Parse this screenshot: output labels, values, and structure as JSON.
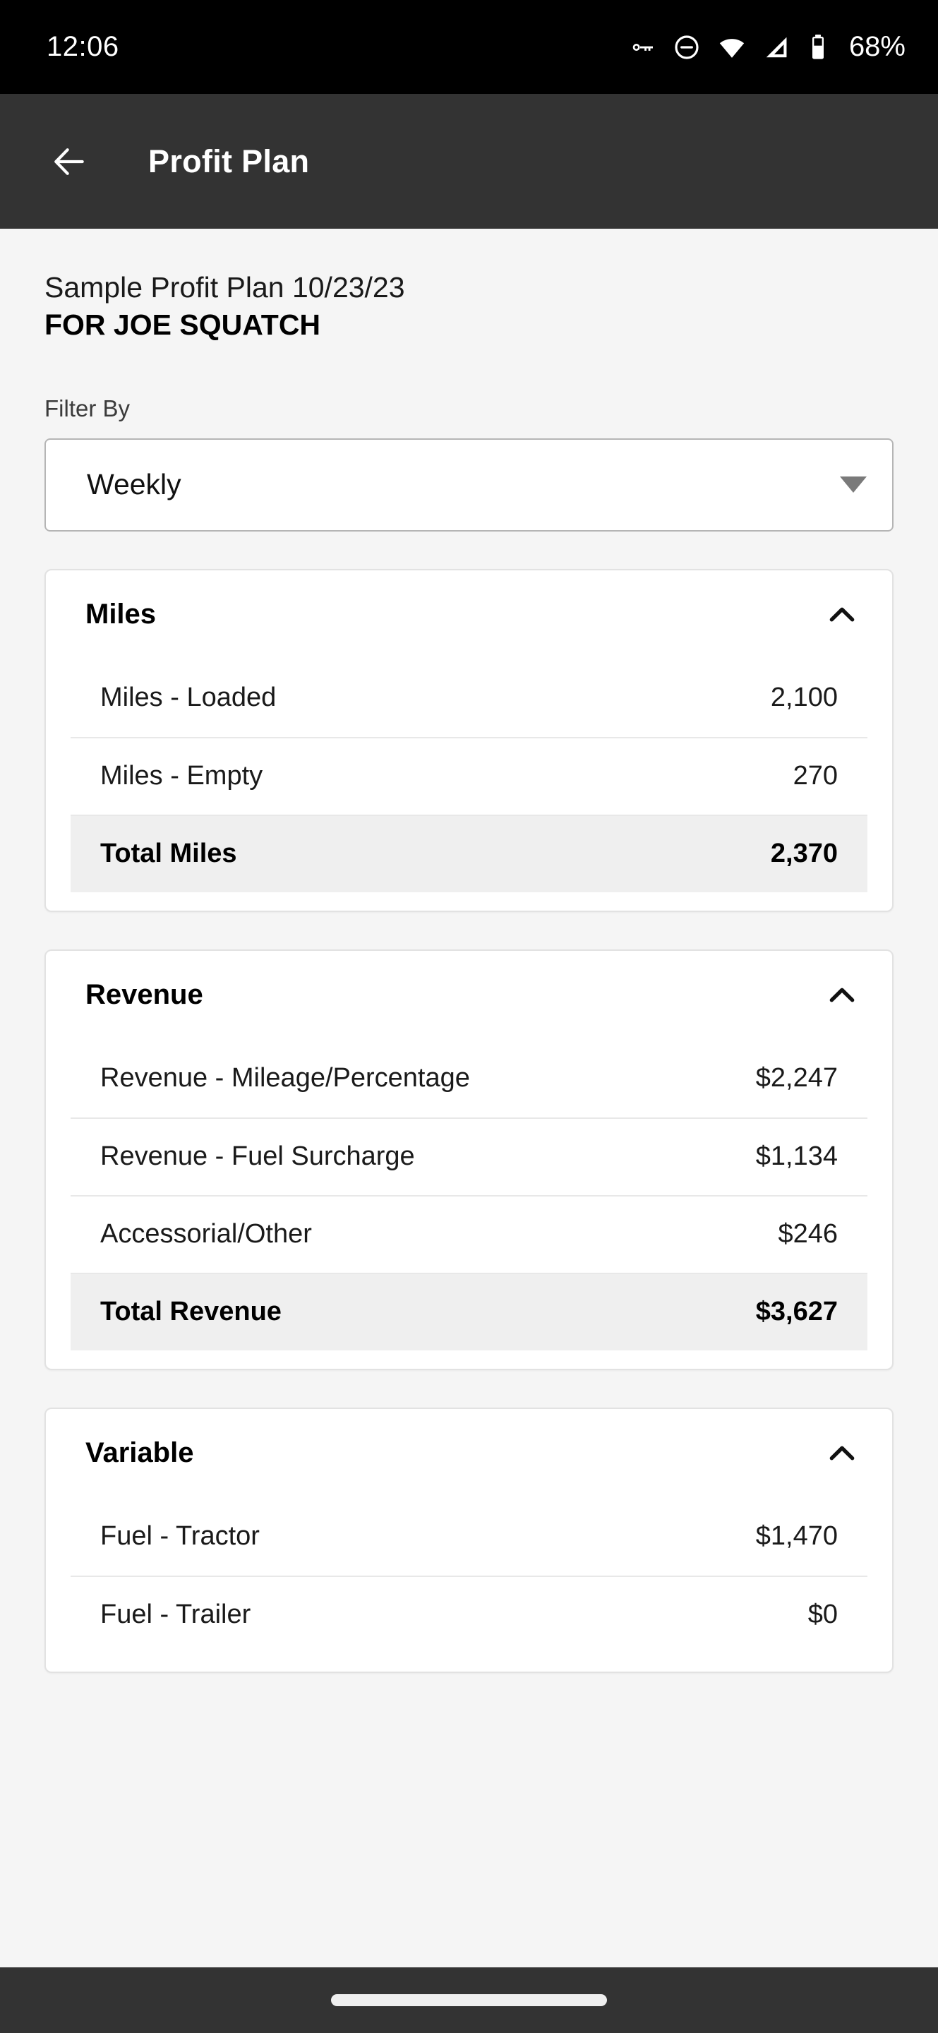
{
  "status_bar": {
    "time": "12:06",
    "battery_label": "68%",
    "icons": [
      "vpn-key-icon",
      "do-not-disturb-icon",
      "wifi-icon",
      "cellular-signal-icon",
      "battery-icon"
    ]
  },
  "app_bar": {
    "back_icon": "back-arrow-icon",
    "title": "Profit Plan"
  },
  "plan": {
    "name": "Sample Profit Plan 10/23/23",
    "owner": "FOR JOE SQUATCH"
  },
  "filter": {
    "label": "Filter By",
    "value": "Weekly",
    "dropdown_icon": "chevron-down-icon"
  },
  "colors": {
    "page_background": "#f5f5f5",
    "app_bar": "#333333",
    "status_bar": "#000000",
    "card_background": "#ffffff",
    "card_border": "#e2e2e2",
    "total_row_background": "#efefef",
    "divider": "#e8e8e8"
  },
  "sections": [
    {
      "title": "Miles",
      "collapse_icon": "chevron-up-icon",
      "rows": [
        {
          "label": "Miles - Loaded",
          "value": "2,100",
          "total": false
        },
        {
          "label": "Miles - Empty",
          "value": "270",
          "total": false
        },
        {
          "label": "Total Miles",
          "value": "2,370",
          "total": true
        }
      ]
    },
    {
      "title": "Revenue",
      "collapse_icon": "chevron-up-icon",
      "rows": [
        {
          "label": "Revenue - Mileage/Percentage",
          "value": "$2,247",
          "total": false
        },
        {
          "label": "Revenue - Fuel Surcharge",
          "value": "$1,134",
          "total": false
        },
        {
          "label": "Accessorial/Other",
          "value": "$246",
          "total": false
        },
        {
          "label": "Total Revenue",
          "value": "$3,627",
          "total": true
        }
      ]
    },
    {
      "title": "Variable",
      "collapse_icon": "chevron-up-icon",
      "rows": [
        {
          "label": "Fuel - Tractor",
          "value": "$1,470",
          "total": false
        },
        {
          "label": "Fuel - Trailer",
          "value": "$0",
          "total": false
        }
      ]
    }
  ],
  "nav_bar": {
    "handle": "gesture-home-handle"
  }
}
